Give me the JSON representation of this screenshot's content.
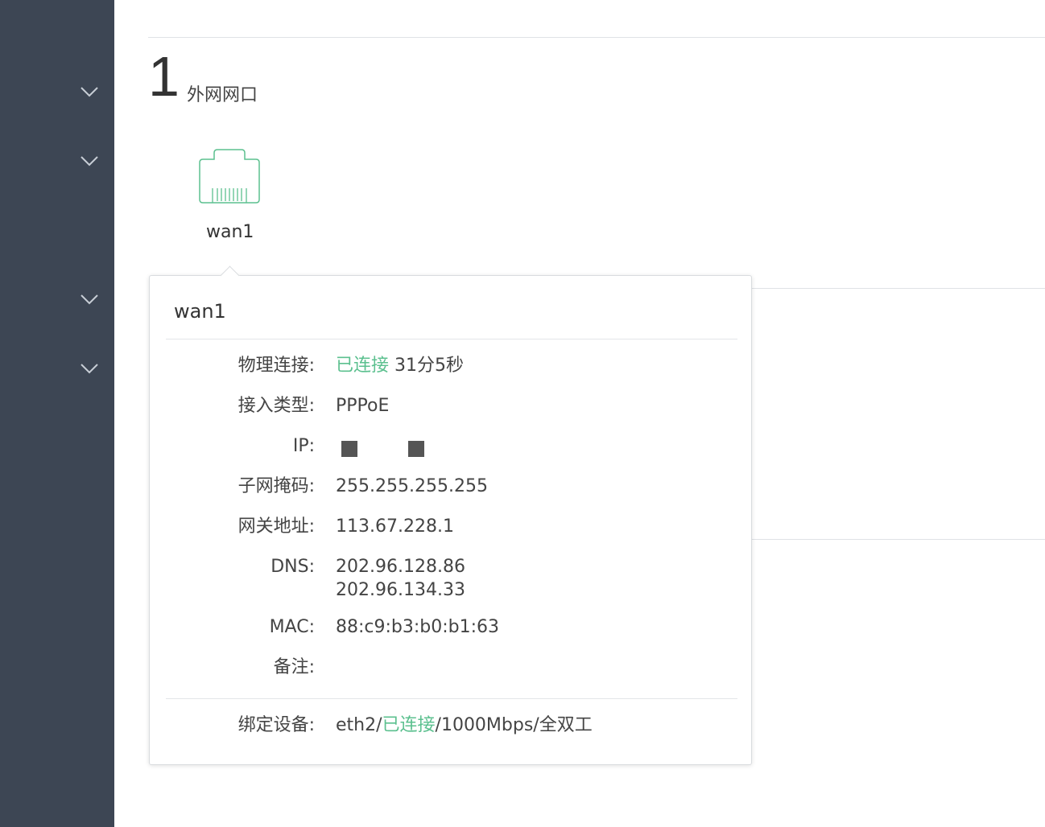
{
  "sidebar": {
    "chevrons": [
      "chevron-down-icon",
      "chevron-down-icon",
      "chevron-down-icon",
      "chevron-down-icon"
    ]
  },
  "section": {
    "number": "1",
    "title": "外网网口"
  },
  "port": {
    "icon": "ethernet-port-icon",
    "label": "wan1"
  },
  "popover": {
    "title": "wan1",
    "rows": {
      "physical": {
        "label": "物理连接:",
        "status": "已连接",
        "duration": "31分5秒"
      },
      "access": {
        "label": "接入类型:",
        "value": "PPPoE"
      },
      "ip": {
        "label": "IP:"
      },
      "subnet": {
        "label": "子网掩码:",
        "value": "255.255.255.255"
      },
      "gateway": {
        "label": "网关地址:",
        "value": "113.67.228.1"
      },
      "dns": {
        "label": "DNS:",
        "values": [
          "202.96.128.86",
          "202.96.134.33"
        ]
      },
      "mac": {
        "label": "MAC:",
        "value": "88:c9:b3:b0:b1:63"
      },
      "note": {
        "label": "备注:",
        "value": ""
      }
    },
    "bound": {
      "label": "绑定设备:",
      "device": "eth2/",
      "status": "已连接",
      "speed": "/1000Mbps/全双工"
    }
  },
  "colors": {
    "sidebar": "#3d4654",
    "accent": "#5cc08f"
  }
}
